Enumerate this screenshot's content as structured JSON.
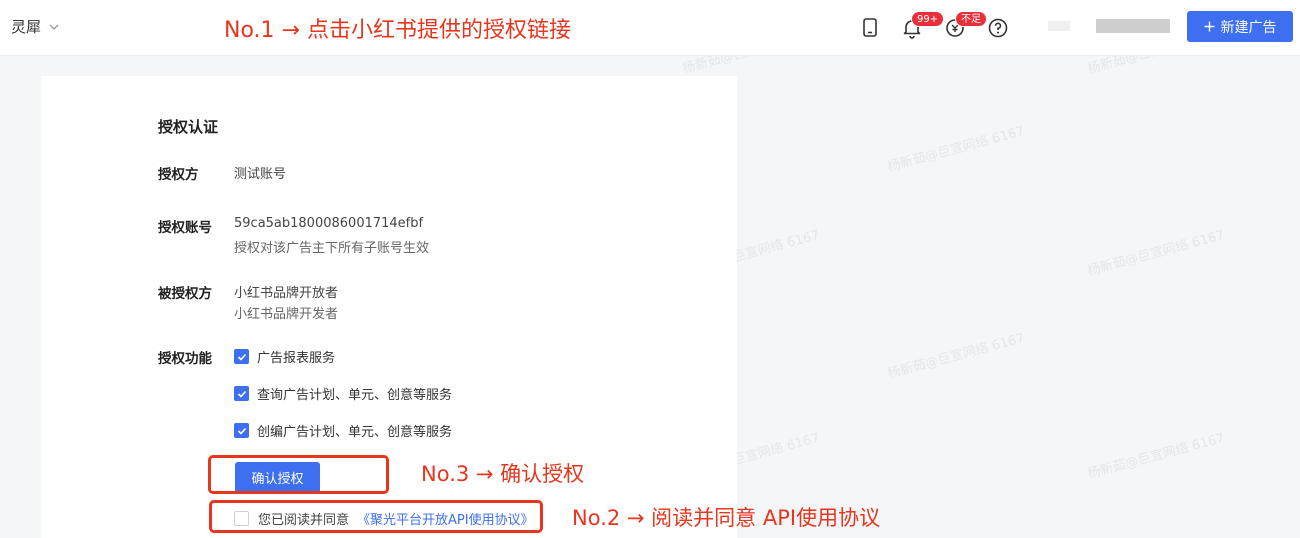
{
  "header": {
    "brand": "灵犀",
    "new_ad_label": "新建广告",
    "bell_badge": "99+",
    "coin_badge": "不足"
  },
  "annotations": {
    "step1": "No.1 → 点击小红书提供的授权链接",
    "step2": "No.2 → 阅读并同意 API使用协议",
    "step3": "No.3 → 确认授权"
  },
  "auth": {
    "title": "授权认证",
    "party_label": "授权方",
    "party_value": "测试账号",
    "account_label": "授权账号",
    "account_value": "59ca5ab1800086001714efbf",
    "account_note": "授权对该广告主下所有子账号生效",
    "grantee_label": "被授权方",
    "grantee_line1": "小红书品牌开放者",
    "grantee_line2": "小红书品牌开发者",
    "functions_label": "授权功能",
    "functions": [
      "广告报表服务",
      "查询广告计划、单元、创意等服务",
      "创编广告计划、单元、创意等服务"
    ],
    "confirm_label": "确认授权",
    "agree_text": "您已阅读并同意",
    "agree_link": "《聚光平台开放API使用协议》"
  },
  "watermark": "杨新茹@巨宣网络 6167",
  "colors": {
    "primary": "#3e6ff1",
    "annotation": "#e7361e",
    "badge": "#e8303a"
  }
}
